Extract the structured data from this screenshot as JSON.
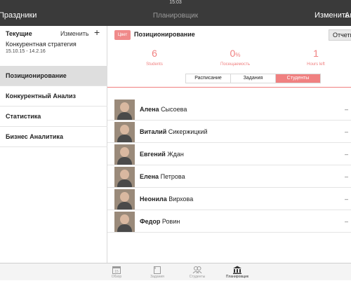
{
  "status_bar": {
    "time": "15:03"
  },
  "nav": {
    "back_label": "Праздники",
    "title": "Планировщик",
    "edit_label": "Изменить",
    "more_label": "Ан"
  },
  "sidebar": {
    "header_label": "Текущие",
    "edit_label": "Изменить",
    "add_symbol": "+",
    "strategy_name": "Конкурентная стратегия",
    "strategy_dates": "15.10.15 - 14.2.16",
    "items": [
      {
        "label": "Позиционирование",
        "active": true
      },
      {
        "label": "Конкурентный Анализ",
        "active": false
      },
      {
        "label": "Статистика",
        "active": false
      },
      {
        "label": "Бизнес Аналитика",
        "active": false
      }
    ]
  },
  "main": {
    "color_tag": "Цвет",
    "title": "Позиционирование",
    "report_label": "Отчеты",
    "stats": [
      {
        "value": "6",
        "suffix": "",
        "label": "Students"
      },
      {
        "value": "0",
        "suffix": "%",
        "label": "Посещаемость"
      },
      {
        "value": "1",
        "suffix": "",
        "label": "Hours left"
      }
    ],
    "tabs": [
      {
        "label": "Расписание",
        "active": false
      },
      {
        "label": "Задания",
        "active": false
      },
      {
        "label": "Студенты",
        "active": true
      }
    ],
    "students": [
      {
        "first": "Алена",
        "last": "Сысоева",
        "value": "–"
      },
      {
        "first": "Виталий",
        "last": "Сикержицкий",
        "value": "–"
      },
      {
        "first": "Евгений",
        "last": "Ждан",
        "value": "–"
      },
      {
        "first": "Елена",
        "last": "Петрова",
        "value": "–"
      },
      {
        "first": "Неонила",
        "last": "Вирхова",
        "value": "–"
      },
      {
        "first": "Федор",
        "last": "Ровин",
        "value": "–"
      }
    ]
  },
  "tabbar": {
    "calendar_day": "15",
    "items": [
      {
        "label": "Обзор",
        "icon": "calendar-icon"
      },
      {
        "label": "Задания",
        "icon": "assignment-icon"
      },
      {
        "label": "Студенты",
        "icon": "students-icon"
      },
      {
        "label": "Планировщик",
        "icon": "planner-icon"
      }
    ]
  },
  "colors": {
    "accent": "#f08080",
    "navbar": "#3a3a3a",
    "selected_row": "#dedede"
  }
}
